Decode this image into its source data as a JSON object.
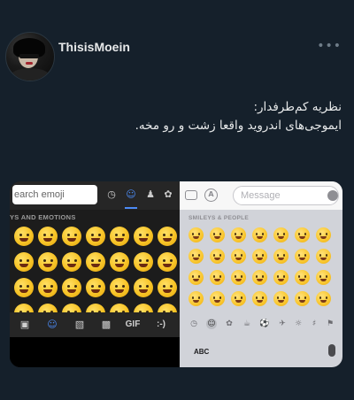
{
  "user": {
    "name": "ThisisMoein",
    "more_label": "•••"
  },
  "tweet": {
    "line1": "نظریه کم‌طرفدار:",
    "line2": "ایموجی‌های اندروید واقعا زشت و رو مخه."
  },
  "android_keyboard": {
    "search_placeholder": "earch emoji",
    "category_label": "YS AND EMOTIONS",
    "tabs": [
      "clock-icon",
      "smiley-icon",
      "person-icon",
      "pet-icon"
    ],
    "bottom_bar": {
      "gif_label": "GIF",
      "emoticon_label": ":-)"
    }
  },
  "ios_keyboard": {
    "message_placeholder": "Message",
    "category_label": "SMILEYS & PEOPLE",
    "abc_label": "ABC"
  }
}
